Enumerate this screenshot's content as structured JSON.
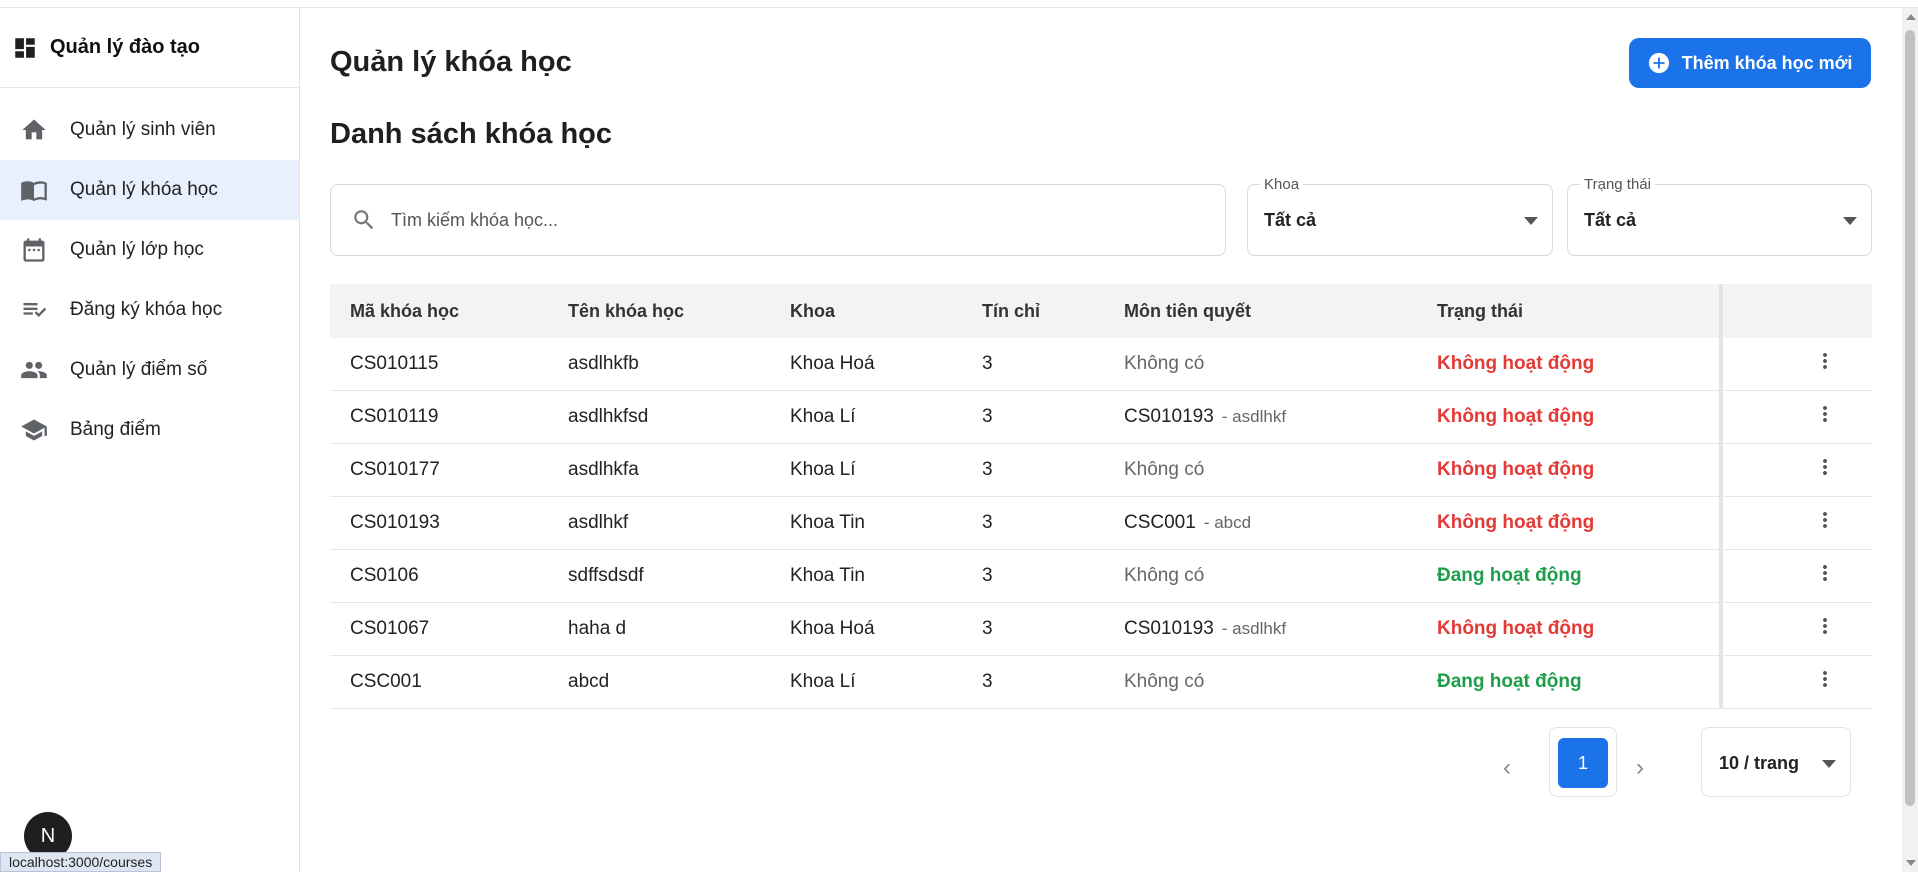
{
  "app": {
    "title": "Quản lý đào tạo"
  },
  "sidebar": {
    "items": [
      {
        "label": "Quản lý sinh viên",
        "icon": "home-icon"
      },
      {
        "label": "Quản lý khóa học",
        "icon": "book-icon",
        "active": true
      },
      {
        "label": "Quản lý lớp học",
        "icon": "calendar-icon"
      },
      {
        "label": "Đăng ký khóa học",
        "icon": "checklist-icon"
      },
      {
        "label": "Quản lý điểm số",
        "icon": "people-icon"
      },
      {
        "label": "Bảng điểm",
        "icon": "school-icon"
      }
    ]
  },
  "header": {
    "title": "Quản lý khóa học",
    "add_button": "Thêm khóa học mới"
  },
  "section": {
    "title": "Danh sách khóa học"
  },
  "search": {
    "placeholder": "Tìm kiếm khóa học...",
    "value": ""
  },
  "filters": {
    "khoa": {
      "label": "Khoa",
      "value": "Tất cả"
    },
    "trang_thai": {
      "label": "Trạng thái",
      "value": "Tất cả"
    }
  },
  "table": {
    "headers": [
      "Mã khóa học",
      "Tên khóa học",
      "Khoa",
      "Tín chỉ",
      "Môn tiên quyết",
      "Trạng thái"
    ],
    "rows": [
      {
        "code": "CS010115",
        "name": "asdlhkfb",
        "dept": "Khoa Hoá",
        "credits": "3",
        "prereq": "Không có",
        "prereq_name": "",
        "status": "Không hoạt động",
        "active": false
      },
      {
        "code": "CS010119",
        "name": "asdlhkfsd",
        "dept": "Khoa Lí",
        "credits": "3",
        "prereq": "CS010193",
        "prereq_name": "- asdlhkf",
        "status": "Không hoạt động",
        "active": false
      },
      {
        "code": "CS010177",
        "name": "asdlhkfa",
        "dept": "Khoa Lí",
        "credits": "3",
        "prereq": "Không có",
        "prereq_name": "",
        "status": "Không hoạt động",
        "active": false
      },
      {
        "code": "CS010193",
        "name": "asdlhkf",
        "dept": "Khoa Tin",
        "credits": "3",
        "prereq": "CSC001",
        "prereq_name": "- abcd",
        "status": "Không hoạt động",
        "active": false
      },
      {
        "code": "CS0106",
        "name": "sdffsdsdf",
        "dept": "Khoa Tin",
        "credits": "3",
        "prereq": "Không có",
        "prereq_name": "",
        "status": "Đang hoạt động",
        "active": true
      },
      {
        "code": "CS01067",
        "name": "haha d",
        "dept": "Khoa Hoá",
        "credits": "3",
        "prereq": "CS010193",
        "prereq_name": "- asdlhkf",
        "status": "Không hoạt động",
        "active": false
      },
      {
        "code": "CSC001",
        "name": "abcd",
        "dept": "Khoa Lí",
        "credits": "3",
        "prereq": "Không có",
        "prereq_name": "",
        "status": "Đang hoạt động",
        "active": true
      }
    ]
  },
  "pagination": {
    "current_page": "1",
    "per_page": "10 / trang"
  },
  "footer": {
    "avatar_letter": "N",
    "status_url": "localhost:3000/courses"
  },
  "colors": {
    "accent": "#1a73e8",
    "inactive": "#e53935",
    "active": "#1e9e4a",
    "active_nav_bg": "#e8f0fe"
  }
}
